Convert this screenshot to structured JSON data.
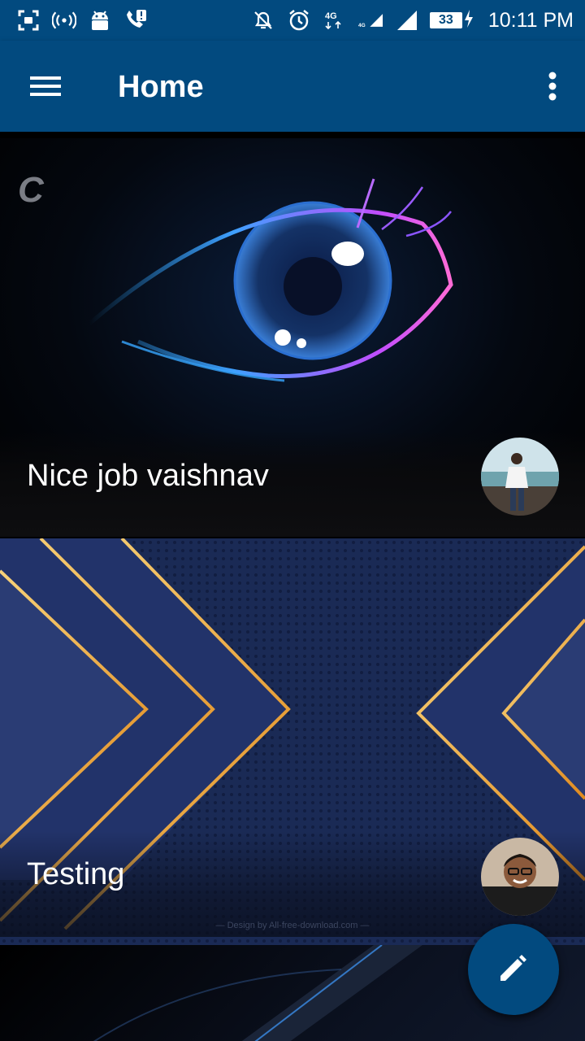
{
  "status_bar": {
    "time": "10:11 PM",
    "battery": "33",
    "icons": [
      "screenshot-icon",
      "hotspot-icon",
      "android-icon",
      "call-alert-icon",
      "mute-icon",
      "alarm-icon",
      "network-4g-icon",
      "signal-icon",
      "signal-icon",
      "battery-icon",
      "charging-icon"
    ]
  },
  "app_bar": {
    "title": "Home",
    "menu_icon": "hamburger-menu-icon",
    "overflow_icon": "more-vert-icon"
  },
  "feed": {
    "posts": [
      {
        "title": "Nice job vaishnav",
        "image": "glowing-eye-artwork",
        "avatar": "user-avatar-beach"
      },
      {
        "title": "Testing",
        "image": "blue-gold-chevron-artwork",
        "avatar": "user-avatar-smiling"
      }
    ],
    "watermark": "— Design by All-free-download.com —"
  },
  "fab": {
    "icon": "edit-pencil-icon"
  },
  "colors": {
    "primary": "#024a7f",
    "text": "#ffffff"
  }
}
